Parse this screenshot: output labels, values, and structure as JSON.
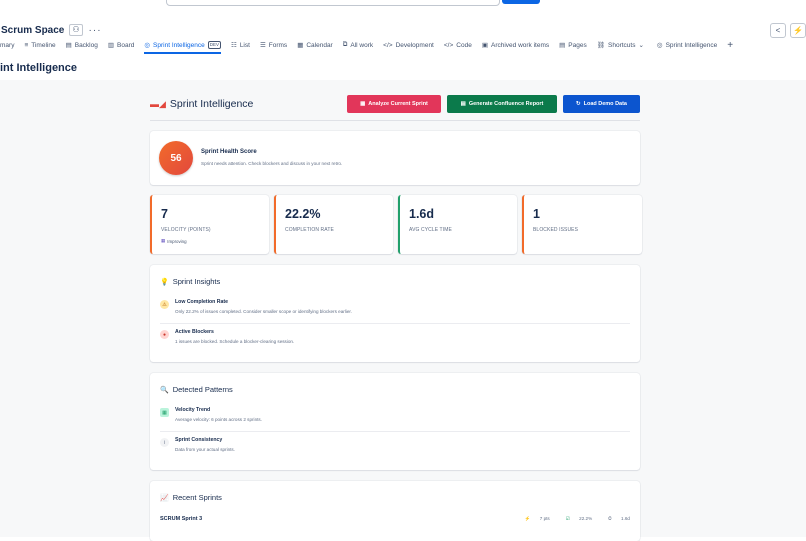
{
  "space": {
    "title": "Scrum Space"
  },
  "tabs": [
    {
      "label": "mary",
      "icon": ""
    },
    {
      "label": "Timeline",
      "icon": "≡"
    },
    {
      "label": "Backlog",
      "icon": "▤"
    },
    {
      "label": "Board",
      "icon": "▥"
    },
    {
      "label": "Sprint Intelligence",
      "icon": "◎",
      "badge": "DEV",
      "active": true
    },
    {
      "label": "List",
      "icon": "☷"
    },
    {
      "label": "Forms",
      "icon": "☰"
    },
    {
      "label": "Calendar",
      "icon": "▦"
    },
    {
      "label": "All work",
      "icon": "⧉"
    },
    {
      "label": "Development",
      "icon": "</>"
    },
    {
      "label": "Code",
      "icon": "</>"
    },
    {
      "label": "Archived work items",
      "icon": "▣"
    },
    {
      "label": "Pages",
      "icon": "▤"
    },
    {
      "label": "Shortcuts",
      "icon": "⛓",
      "dropdown": "⌄"
    },
    {
      "label": "Sprint Intelligence",
      "icon": "◎"
    }
  ],
  "add_tab": "+",
  "page_title": "int Intelligence",
  "app": {
    "title": "Sprint Intelligence",
    "buttons": {
      "analyze": "Analyze Current Sprint",
      "generate": "Generate Confluence Report",
      "demo": "Load Demo Data"
    }
  },
  "health": {
    "score": "56",
    "title": "Sprint Health Score",
    "description": "Sprint needs attention. Check blockers and discuss in your next retro."
  },
  "metrics": [
    {
      "value": "7",
      "label": "VELOCITY (POINTS)",
      "sub": "Improving",
      "color": "#f26b2a"
    },
    {
      "value": "22.2%",
      "label": "COMPLETION RATE",
      "sub": "",
      "color": "#f26b2a"
    },
    {
      "value": "1.6d",
      "label": "AVG CYCLE TIME",
      "sub": "",
      "color": "#22a06b"
    },
    {
      "value": "1",
      "label": "BLOCKED ISSUES",
      "sub": "",
      "color": "#f26b2a"
    }
  ],
  "insights": {
    "title": "Sprint Insights",
    "items": [
      {
        "title": "Low Completion Rate",
        "desc": "Only 22.2% of issues completed. Consider smaller scope or identifying blockers earlier.",
        "icon": "⚠",
        "bg": "#ffe7a3",
        "fg": "#b65c02"
      },
      {
        "title": "Active Blockers",
        "desc": "1 issues are blocked. Schedule a blocker-clearing session.",
        "icon": "●",
        "bg": "#ffd5d2",
        "fg": "#c9372c"
      }
    ]
  },
  "patterns": {
    "title": "Detected Patterns",
    "items": [
      {
        "title": "Velocity Trend",
        "desc": "Average velocity: 6 points across 2 sprints.",
        "icon": "▦",
        "bg": "#baf3db",
        "fg": "#22a06b"
      },
      {
        "title": "Sprint Consistency",
        "desc": "Data from your actual sprints.",
        "icon": "i",
        "bg": "#f1f2f4",
        "fg": "#626f86"
      }
    ]
  },
  "recent": {
    "title": "Recent Sprints",
    "sprint": {
      "name": "SCRUM Sprint 3",
      "points": "7 pts",
      "completion": "22.2%",
      "cycle": "1.6d"
    }
  }
}
